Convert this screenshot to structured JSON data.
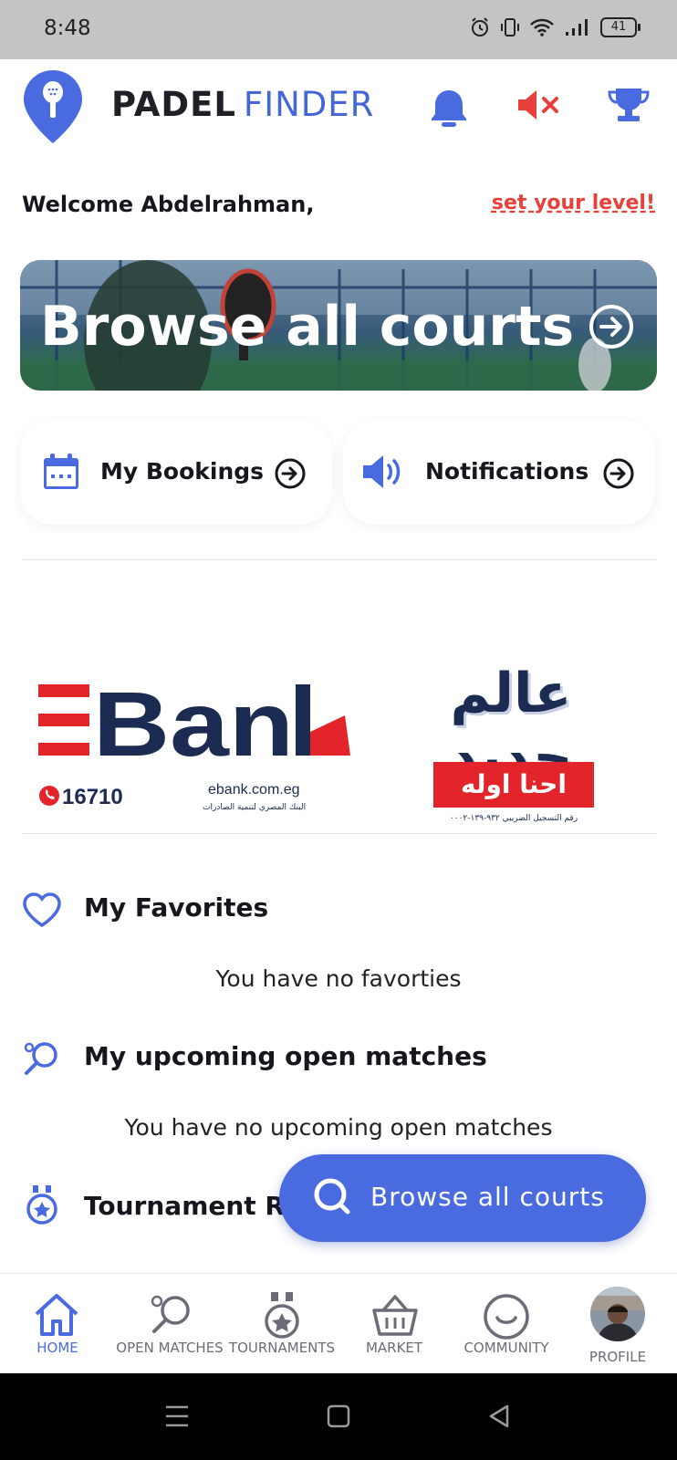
{
  "status_bar": {
    "time": "8:48",
    "battery": "41"
  },
  "header": {
    "brand_bold": "PADEL",
    "brand_light": "FINDER",
    "colors": {
      "accent": "#4a6be0",
      "mute": "#e8403a"
    }
  },
  "welcome": {
    "greeting": "Welcome Abdelrahman,",
    "set_level": "set your level!"
  },
  "banner": {
    "title": "Browse all courts"
  },
  "quick_cards": [
    {
      "label": "My Bookings",
      "icon": "calendar-icon"
    },
    {
      "label": "Notifications",
      "icon": "speaker-icon"
    }
  ],
  "ads": {
    "ebank": {
      "brand": "EBank",
      "hotline": "16710",
      "website": "ebank.com.eg",
      "subtitle_ar": "البنك المصري لتنمية الصادرات"
    },
    "campaign": {
      "headline_ar": "عالم جديد",
      "tagline_ar": "احنا اوله",
      "registration_ar": "رقم التسجيل الضريبي ٩٣٢-١٣٩-٠٠٠٢"
    }
  },
  "sections": {
    "favorites": {
      "title": "My Favorites",
      "empty": "You have no favorties"
    },
    "matches": {
      "title": "My upcoming open matches",
      "empty": "You have no upcoming open matches"
    },
    "tournaments": {
      "title": "Tournament Re"
    }
  },
  "fab": {
    "label": "Browse all courts"
  },
  "bottom_nav": [
    {
      "label": "HOME",
      "active": true
    },
    {
      "label": "OPEN MATCHES"
    },
    {
      "label": "TOURNAMENTS"
    },
    {
      "label": "MARKET"
    },
    {
      "label": "COMMUNITY"
    },
    {
      "label": "PROFILE"
    }
  ]
}
